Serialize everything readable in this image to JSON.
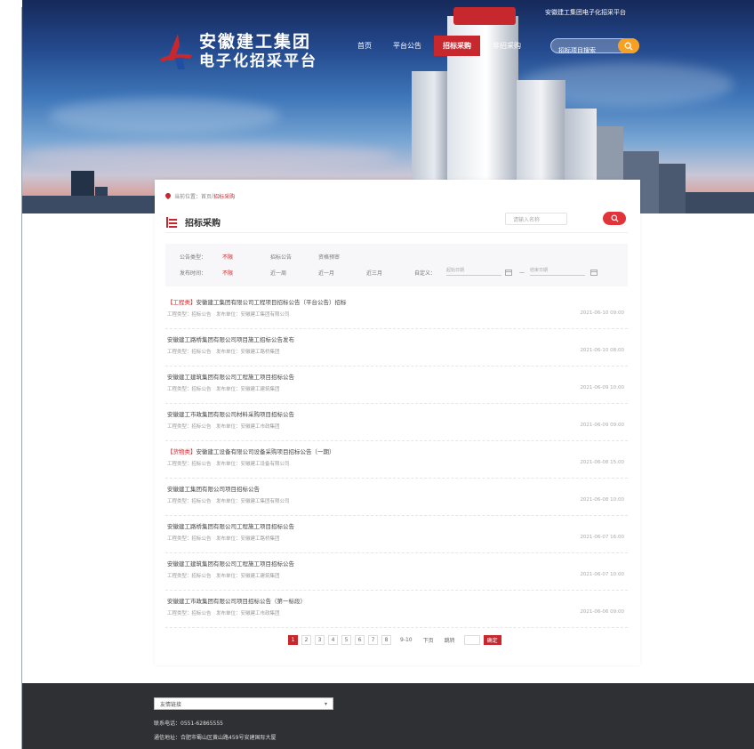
{
  "header": {
    "logo_line1": "安徽建工集团",
    "logo_line2": "电子化招采平台",
    "top_notice": "安徽建工集团电子化招采平台",
    "nav": [
      "首页",
      "平台公告",
      "招标采购",
      "非招采购"
    ],
    "active_nav_index": 2,
    "search_placeholder": "招标项目搜索"
  },
  "breadcrumb": {
    "home": "当前位置：",
    "first": "首页",
    "sep": " / ",
    "current": "招标采购"
  },
  "section": {
    "title": "招标采购",
    "filter_placeholder": "请输入名称"
  },
  "filters": {
    "row1": {
      "label": "公告类型：",
      "options": [
        "不限",
        "招标公告",
        "资格预审"
      ]
    },
    "row2": {
      "label": "发布时间：",
      "options": [
        "不限",
        "近一周",
        "近一月",
        "近三月"
      ],
      "custom_label": "自定义：",
      "start_placeholder": "起始日期",
      "end_placeholder": "结束日期"
    }
  },
  "list": [
    {
      "tag": "【工程类】",
      "title": "安徽建工集团有限公司工程项目招标公告（平台公告）招标",
      "sub": "工程类型：招标公告　发布单位：安徽建工集团有限公司",
      "date": "2021-06-10 09:00"
    },
    {
      "tag": "",
      "title": "安徽建工路桥集团有限公司项目施工招标公告发布",
      "sub": "工程类型：招标公告　发布单位：安徽建工路桥集团",
      "date": "2021-06-10 08:00"
    },
    {
      "tag": "",
      "title": "安徽建工建筑集团有限公司工程施工项目招标公告",
      "sub": "工程类型：招标公告　发布单位：安徽建工建筑集团",
      "date": "2021-06-09 10:00"
    },
    {
      "tag": "",
      "title": "安徽建工市政集团有限公司材料采购项目招标公告",
      "sub": "工程类型：招标公告　发布单位：安徽建工市政集团",
      "date": "2021-06-09 09:00"
    },
    {
      "tag": "【货物类】",
      "title": "安徽建工设备有限公司设备采购项目招标公告（一期）",
      "sub": "工程类型：招标公告　发布单位：安徽建工设备有限公司",
      "date": "2021-06-08 15:00"
    },
    {
      "tag": "",
      "title": "安徽建工集团有限公司项目招标公告",
      "sub": "工程类型：招标公告　发布单位：安徽建工集团有限公司",
      "date": "2021-06-08 10:00"
    },
    {
      "tag": "",
      "title": "安徽建工路桥集团有限公司工程施工项目招标公告",
      "sub": "工程类型：招标公告　发布单位：安徽建工路桥集团",
      "date": "2021-06-07 16:00"
    },
    {
      "tag": "",
      "title": "安徽建工建筑集团有限公司工程施工项目招标公告",
      "sub": "工程类型：招标公告　发布单位：安徽建工建筑集团",
      "date": "2021-06-07 10:00"
    },
    {
      "tag": "",
      "title": "安徽建工市政集团有限公司项目招标公告（第一标段）",
      "sub": "工程类型：招标公告　发布单位：安徽建工市政集团",
      "date": "2021-06-06 09:00"
    }
  ],
  "pager": {
    "pages": [
      "1",
      "2",
      "3",
      "4",
      "5",
      "6",
      "7",
      "8"
    ],
    "active_index": 0,
    "ellipsis": "9-10",
    "next": "下页",
    "goto": "跳转",
    "go": "确定"
  },
  "footer": {
    "select_label": "友情链接",
    "phone": "联系电话：0551-62865555",
    "address": "通信地址：合肥市蜀山区黄山路459号安建国际大厦"
  },
  "colors": {
    "brand": "#c7282e",
    "accent": "#f6a124",
    "footer_bg": "#2e3033"
  }
}
